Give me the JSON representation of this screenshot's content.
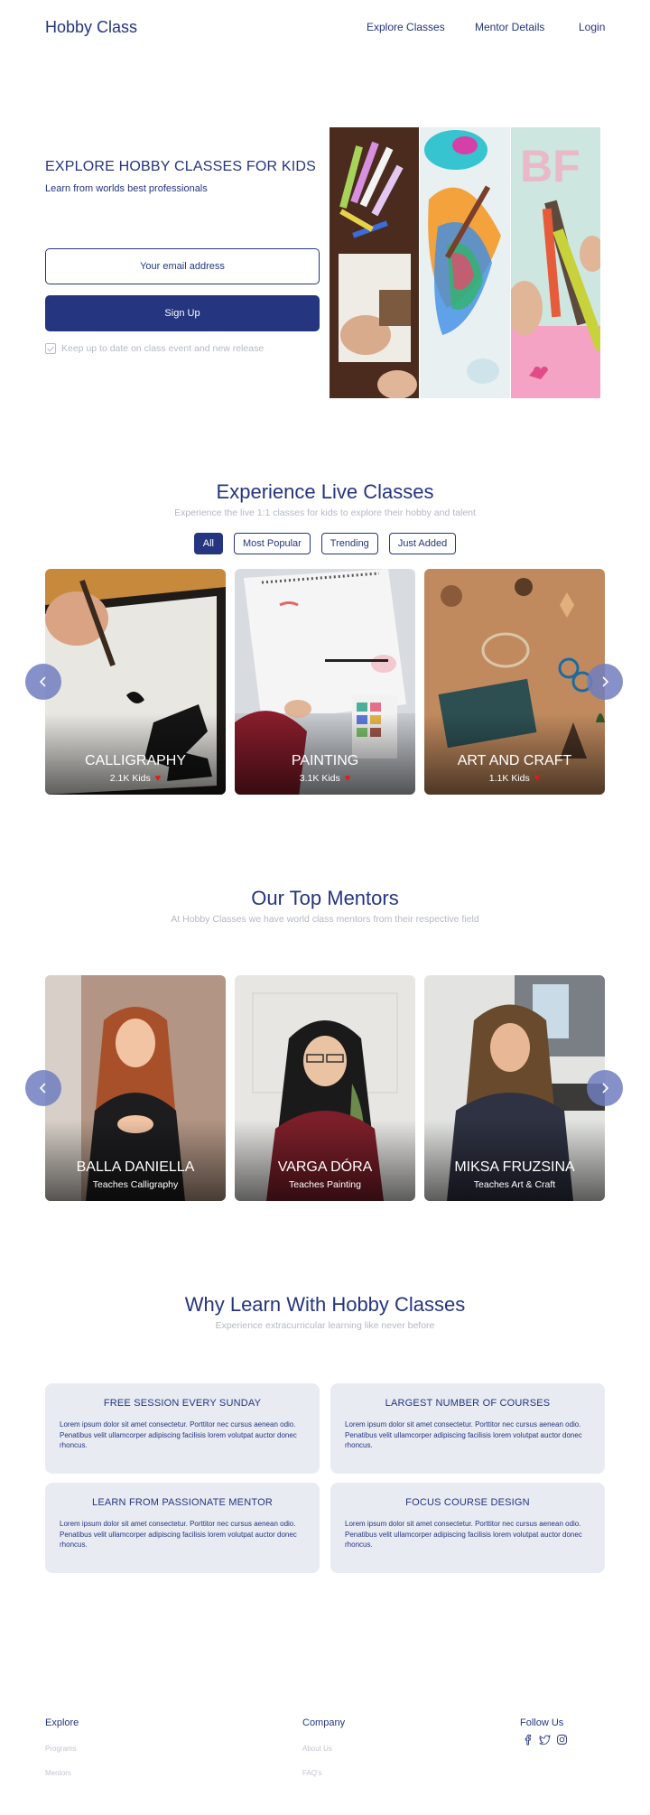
{
  "nav": {
    "brand": "Hobby Class",
    "links": [
      "Explore Classes",
      "Mentor Details",
      "Login"
    ]
  },
  "hero": {
    "title": "EXPLORE HOBBY CLASSES FOR KIDS",
    "subtitle": "Learn from worlds best professionals",
    "email_placeholder": "Your email address",
    "signup_label": "Sign Up",
    "keep_updated": "Keep up to date on class event and new release"
  },
  "live": {
    "title": "Experience Live Classes",
    "subtitle": "Experience the live 1:1 classes for kids to explore their hobby and talent",
    "filters": [
      "All",
      "Most Popular",
      "Trending",
      "Just Added"
    ],
    "active_filter": "All",
    "cards": [
      {
        "title": "CALLIGRAPHY",
        "kids": "2.1K Kids"
      },
      {
        "title": "PAINTING",
        "kids": "3.1K Kids"
      },
      {
        "title": "ART AND CRAFT",
        "kids": "1.1K Kids"
      }
    ]
  },
  "mentors": {
    "title": "Our Top Mentors",
    "subtitle": "At Hobby Classes we have world class mentors from their respective field",
    "cards": [
      {
        "name": "BALLA DANIELLA",
        "teaches": "Teaches Calligraphy"
      },
      {
        "name": "VARGA DÓRA",
        "teaches": "Teaches Painting"
      },
      {
        "name": "MIKSA FRUZSINA",
        "teaches": "Teaches Art & Craft"
      }
    ]
  },
  "why": {
    "title": "Why Learn With Hobby Classes",
    "subtitle": "Experience extracurricular learning like never before",
    "items": [
      {
        "title": "FREE SESSION EVERY SUNDAY",
        "text": "Lorem ipsum dolor sit amet consectetur. Porttitor nec cursus aenean odio. Penatibus velit ullamcorper adipiscing facilisis lorem volutpat auctor donec rhoncus."
      },
      {
        "title": "LARGEST NUMBER OF COURSES",
        "text": "Lorem ipsum dolor sit amet consectetur. Porttitor nec cursus aenean odio. Penatibus velit ullamcorper adipiscing facilisis lorem volutpat auctor donec rhoncus."
      },
      {
        "title": "LEARN FROM PASSIONATE MENTOR",
        "text": "Lorem ipsum dolor sit amet consectetur. Porttitor nec cursus aenean odio. Penatibus velit ullamcorper adipiscing facilisis lorem volutpat auctor donec rhoncus."
      },
      {
        "title": "FOCUS COURSE DESIGN",
        "text": "Lorem ipsum dolor sit amet consectetur. Porttitor nec cursus aenean odio. Penatibus velit ullamcorper adipiscing facilisis lorem volutpat auctor donec rhoncus."
      }
    ]
  },
  "footer": {
    "explore": {
      "heading": "Explore",
      "links": [
        "Programs",
        "Mentors"
      ]
    },
    "company": {
      "heading": "Company",
      "links": [
        "About Us",
        "FAQ's"
      ]
    },
    "follow": {
      "heading": "Follow Us",
      "icons": [
        "facebook-icon",
        "twitter-icon",
        "instagram-icon"
      ]
    }
  },
  "colors": {
    "primary": "#25357f",
    "muted": "#b4b8c4",
    "card_bg": "#e8ebf2",
    "arrow": "#707ebe",
    "heart": "#e21a1a"
  }
}
